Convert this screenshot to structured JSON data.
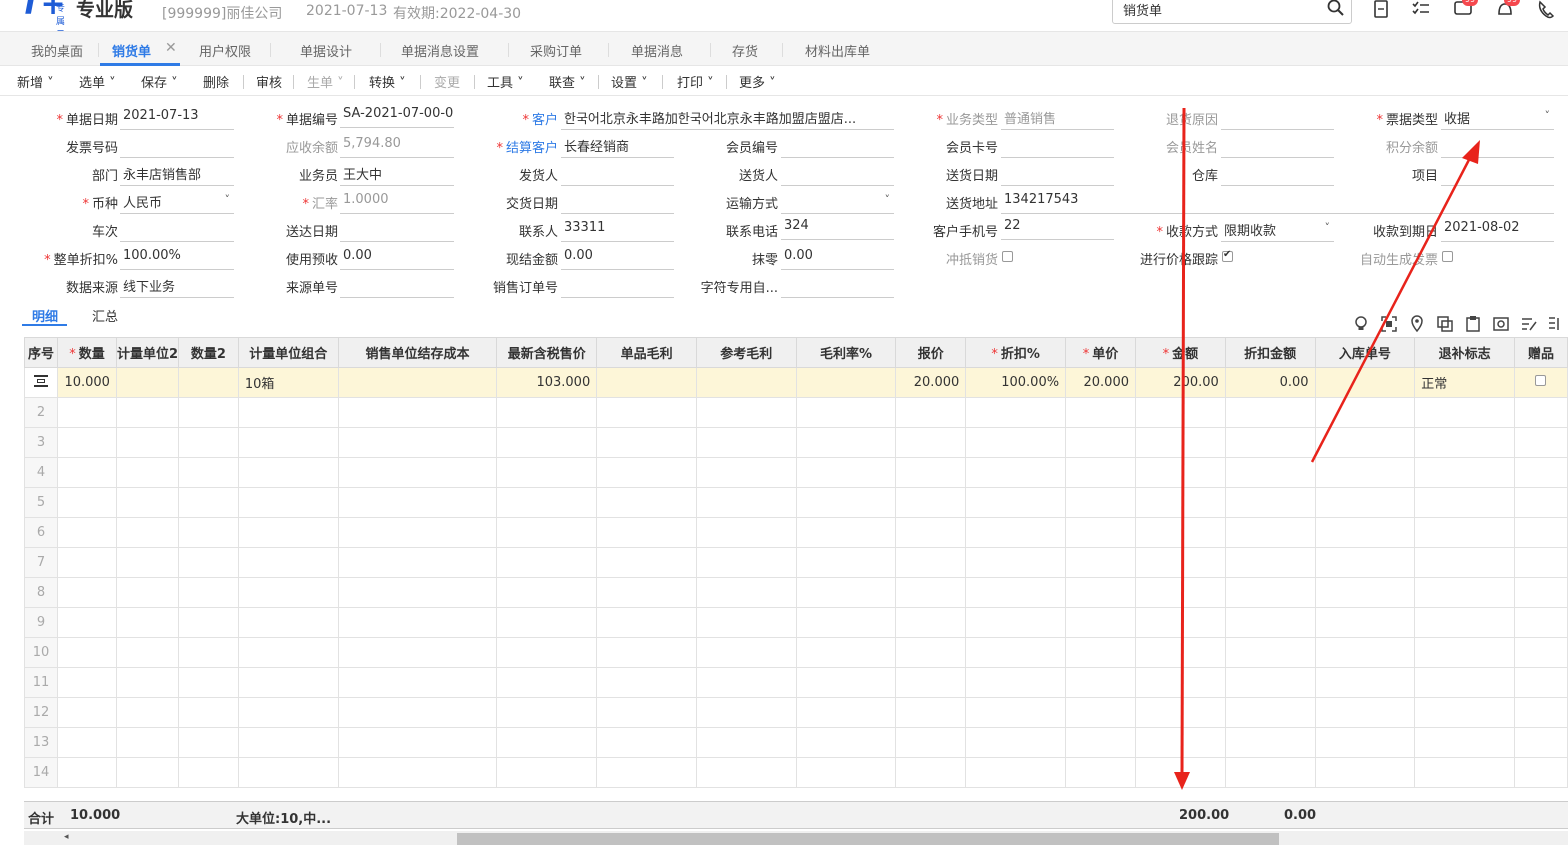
{
  "header": {
    "logo_text": "T+",
    "logo_sub": "专属云",
    "edition": "专业版",
    "company": "[999999]丽佳公司",
    "date": "2021-07-13",
    "valid": "有效期:2022-04-30",
    "search_value": "销货单",
    "badges": [
      "99",
      "99"
    ]
  },
  "tabs": [
    "我的桌面",
    "销货单",
    "用户权限",
    "单据设计",
    "单据消息设置",
    "采购订单",
    "单据消息",
    "存货",
    "材料出库单"
  ],
  "toolbar": [
    "新增",
    "选单",
    "保存",
    "删除",
    "审核",
    "生单",
    "转换",
    "变更",
    "工具",
    "联查",
    "设置",
    "打印",
    "更多"
  ],
  "form": {
    "date_label": "单据日期",
    "date": "2021-07-13",
    "no_label": "单据编号",
    "no": "SA-2021-07-00-0...",
    "customer_label": "客户",
    "customer": "한국어北京永丰路加한국어北京永丰路加盟店盟店...",
    "biz_type_label": "业务类型",
    "biz_type": "普通销售",
    "return_reason_label": "退货原因",
    "ticket_type_label": "票据类型",
    "ticket_type": "收据",
    "invoice_label": "发票号码",
    "receivable_label": "应收余额",
    "receivable": "5,794.80",
    "settle_label": "结算客户",
    "settle": "长春经销商",
    "member_no_label": "会员编号",
    "member_card_label": "会员卡号",
    "member_name_label": "会员姓名",
    "points_label": "积分余额",
    "dept_label": "部门",
    "dept": "永丰店销售部",
    "salesman_label": "业务员",
    "salesman": "王大中",
    "shipper_label": "发货人",
    "deliverer_label": "送货人",
    "deliver_date_label": "送货日期",
    "warehouse_label": "仓库",
    "project_label": "项目",
    "currency_label": "币种",
    "currency": "人民币",
    "rate_label": "汇率",
    "rate": "1.0000",
    "trade_date_label": "交货日期",
    "transport_label": "运输方式",
    "address_label": "送货地址",
    "address": "134217543",
    "vehicle_label": "车次",
    "arrive_label": "送达日期",
    "contact_label": "联系人",
    "contact": "33311",
    "phone_label": "联系电话",
    "phone": "324",
    "mobile_label": "客户手机号",
    "mobile": "22",
    "pay_method_label": "收款方式",
    "pay_method": "限期收款",
    "pay_due_label": "收款到期日",
    "pay_due": "2021-08-02",
    "discount_label": "整单折扣%",
    "discount": "100.00%",
    "prepay_label": "使用预收",
    "prepay": "0.00",
    "cash_label": "现结金额",
    "cash": "0.00",
    "round_label": "抹零",
    "round": "0.00",
    "offset_label": "冲抵销货",
    "track_label": "进行价格跟踪",
    "auto_invoice_label": "自动生成发票",
    "source_label": "数据来源",
    "source": "线下业务",
    "source_no_label": "来源单号",
    "order_no_label": "销售订单号",
    "custom_label": "字符专用自..."
  },
  "detail_tabs": [
    "明细",
    "汇总"
  ],
  "grid": {
    "headers": [
      "序号",
      "数量",
      "计量单位2",
      "数量2",
      "计量单位组合",
      "销售单位结存成本",
      "最新含税售价",
      "单品毛利",
      "参考毛利",
      "毛利率%",
      "报价",
      "折扣%",
      "单价",
      "金额",
      "折扣金额",
      "入库单号",
      "退补标志",
      "赠品"
    ],
    "required": [
      false,
      true,
      false,
      false,
      false,
      false,
      false,
      false,
      false,
      false,
      false,
      true,
      true,
      true,
      false,
      false,
      false,
      false
    ],
    "row1": {
      "qty": "10.000",
      "unit_combo": "10箱",
      "latest_price": "103.000",
      "quote": "20.000",
      "discount": "100.00%",
      "price": "20.000",
      "amount": "200.00",
      "discount_amount": "0.00",
      "flag": "正常"
    },
    "empty_rows": [
      "2",
      "3",
      "4",
      "5",
      "6",
      "7",
      "8",
      "9",
      "10",
      "11",
      "12",
      "13",
      "14"
    ]
  },
  "totals": {
    "label": "合计",
    "qty": "10.000",
    "units": "大单位:10,中...",
    "amount": "200.00",
    "discount_amount": "0.00"
  },
  "colors": {
    "accent": "#2f7be6",
    "selected_row": "#fdf6d8",
    "arrow": "#e8231b"
  }
}
